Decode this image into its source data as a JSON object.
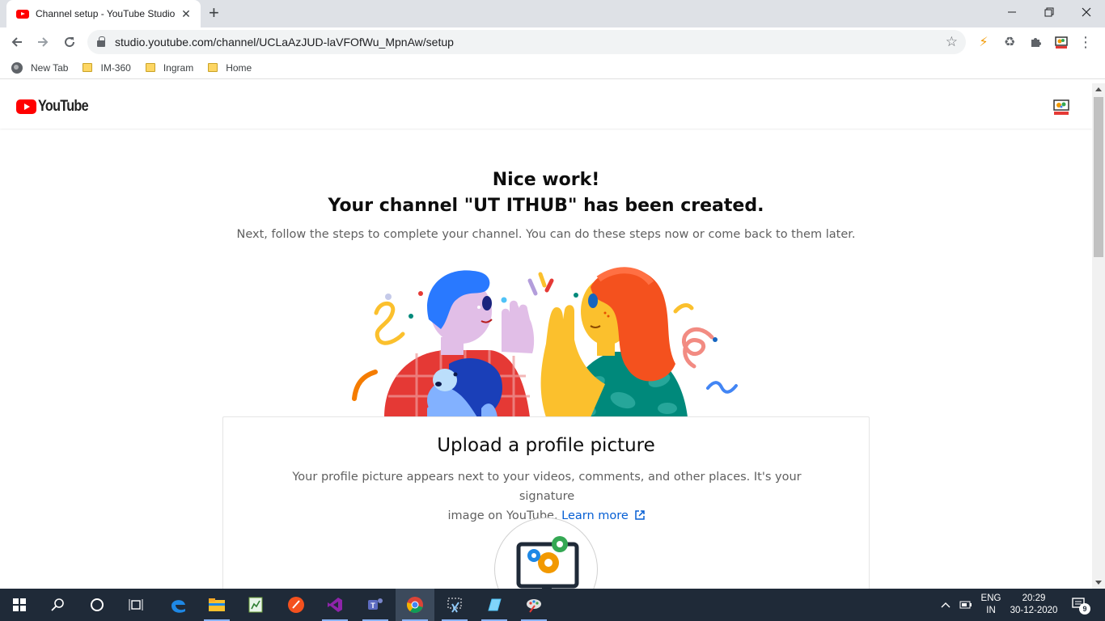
{
  "browser": {
    "tab_title": "Channel setup - YouTube Studio",
    "tab_close": "✕",
    "new_tab": "+",
    "url": "studio.youtube.com/channel/UCLaAzJUD-laVFOfWu_MpnAw/setup",
    "bookmarks": [
      "New Tab",
      "IM-360",
      "Ingram",
      "Home"
    ]
  },
  "page": {
    "logo_text": "YouTube",
    "heading_line1": "Nice work!",
    "heading_line2": "Your channel \"UT ITHUB\" has been created.",
    "subtext": "Next, follow the steps to complete your channel. You can do these steps now or come back to them later.",
    "card": {
      "title": "Upload a profile picture",
      "description_line1": "Your profile picture appears next to your videos, comments, and other places. It's your signature",
      "description_line2_prefix": "image on YouTube.",
      "learn_more": "Learn more"
    }
  },
  "taskbar": {
    "lang_top": "ENG",
    "lang_bottom": "IN",
    "time": "20:29",
    "date": "30-12-2020",
    "notification_count": "9"
  },
  "colors": {
    "brand_red": "#ff0000",
    "link_blue": "#065fd4",
    "taskbar": "#1f2a38"
  }
}
